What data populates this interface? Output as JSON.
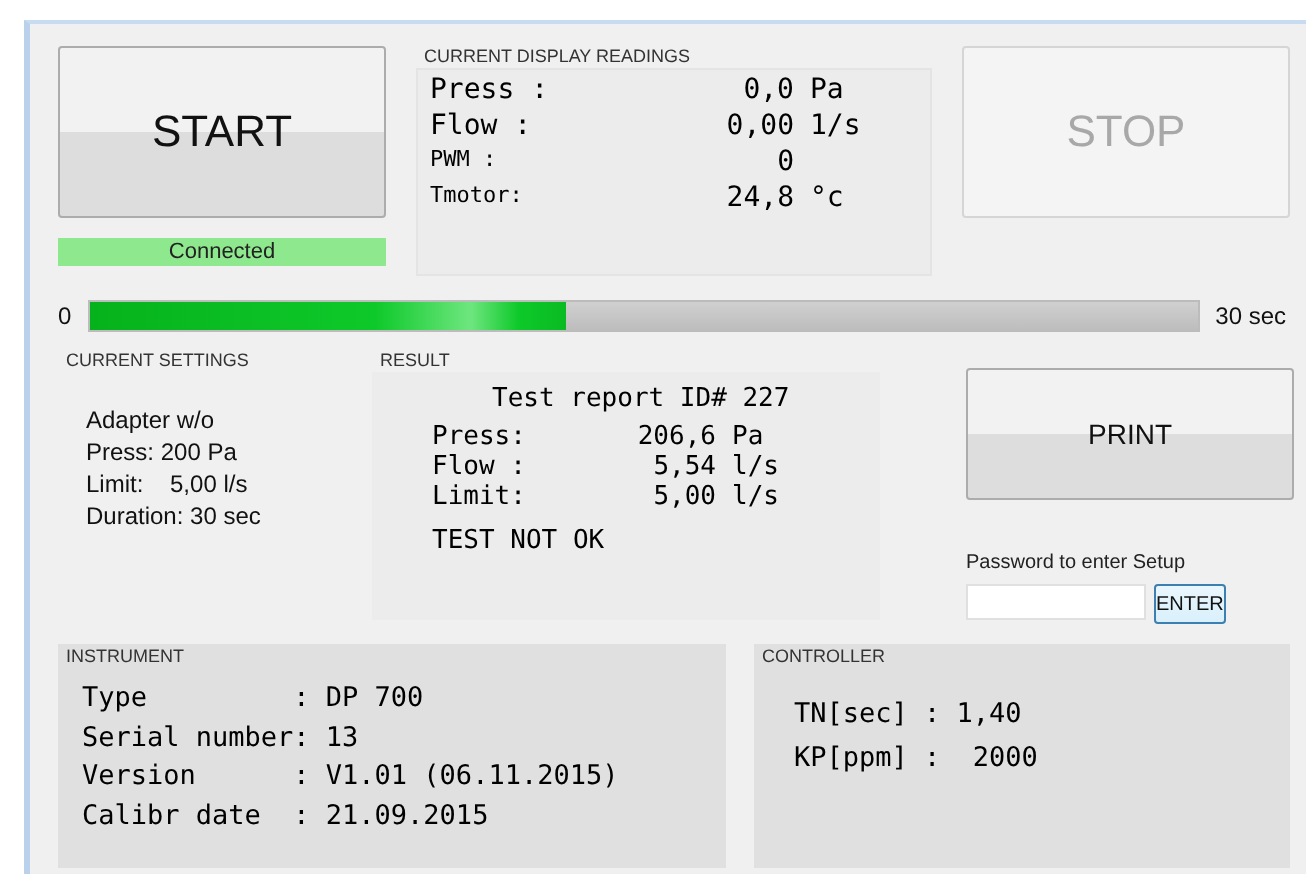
{
  "start_button": {
    "label": "START"
  },
  "connection": {
    "label": "Connected",
    "connected": true
  },
  "readings": {
    "title": "CURRENT DISPLAY READINGS",
    "rows": [
      {
        "label": "Press :",
        "value": "0,0",
        "unit": "Pa"
      },
      {
        "label": "Flow  :",
        "value": "0,00",
        "unit": "1/s"
      },
      {
        "label": "PWM   :",
        "value": "0"
      },
      {
        "label": "Tmotor:",
        "value": "24,8",
        "unit": "°c"
      }
    ]
  },
  "stop_button": {
    "label": "STOP",
    "disabled": true
  },
  "progress": {
    "min_label": "0",
    "max_label": "30 sec",
    "level": 0.43
  },
  "settings": {
    "title": "CURRENT SETTINGS",
    "lines": [
      "Adapter w/o",
      "Press: 200 Pa",
      "Limit:    5,00 l/s",
      "Duration: 30 sec"
    ]
  },
  "result": {
    "title": "RESULT",
    "heading": "Test report ID# 227",
    "rows": [
      {
        "label": "Press:",
        "value": "206,6",
        "unit": "Pa"
      },
      {
        "label": "Flow :",
        "value": "5,54",
        "unit": "l/s"
      },
      {
        "label": "Limit:",
        "value": "5,00",
        "unit": "l/s"
      }
    ],
    "verdict": "TEST NOT OK"
  },
  "print_button": {
    "label": "PRINT"
  },
  "password": {
    "label": "Password to enter Setup"
  },
  "enter_button": {
    "label": "ENTER"
  },
  "instrument": {
    "title": "INSTRUMENT",
    "lines": [
      "Type         : DP 700",
      "Serial number: 13",
      "Version      : V1.01 (06.11.2015)",
      "Calibr date  : 21.09.2015"
    ]
  },
  "controller": {
    "title": "CONTROLLER",
    "lines": [
      "TN[sec] : 1,40",
      "KP[ppm] :  2000"
    ]
  }
}
